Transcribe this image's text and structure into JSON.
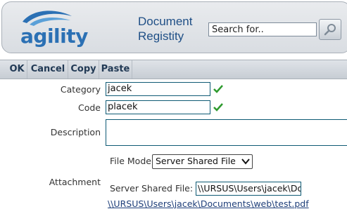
{
  "header": {
    "logo_text": "agility",
    "title_line1": "Document",
    "title_line2": "Registity",
    "search": {
      "placeholder": "Search for..",
      "value": ""
    }
  },
  "toolbar": {
    "ok_label": "OK",
    "cancel_label": "Cancel",
    "copy_label": "Copy",
    "paste_label": "Paste"
  },
  "form": {
    "category_label": "Category",
    "category_value": "jacek",
    "code_label": "Code",
    "code_value": "placek",
    "description_label": "Description",
    "description_value": "",
    "file_mode_label": "File Mode",
    "file_mode_selected": "Server Shared File",
    "attachment_label": "Attachment",
    "server_shared_file_label": "Server Shared File:",
    "server_shared_file_value": "\\\\URSUS\\Users\\jacek\\Documents\\web\\test.pdf",
    "file_link": "\\\\URSUS\\Users\\jacek\\Documents\\web\\test.pdf"
  },
  "colors": {
    "brand_blue": "#2b70b4",
    "title_blue": "#1f4f86",
    "check_green": "#2e9a2e",
    "field_border": "#0e5a74"
  },
  "icons": [
    "logo-wave-icon",
    "search-icon",
    "check-icon",
    "chevron-down-icon"
  ]
}
